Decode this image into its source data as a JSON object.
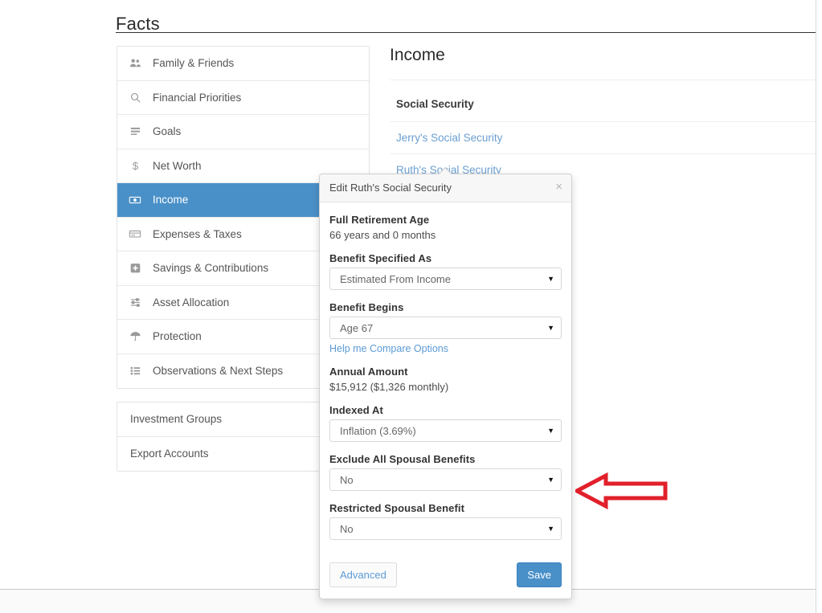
{
  "page": {
    "title": "Facts"
  },
  "sidebar": {
    "groups": [
      {
        "items": [
          {
            "label": "Family & Friends",
            "icon": "people-icon",
            "active": false
          },
          {
            "label": "Financial Priorities",
            "icon": "search-icon",
            "active": false
          },
          {
            "label": "Goals",
            "icon": "list-bars-icon",
            "active": false
          },
          {
            "label": "Net Worth",
            "icon": "dollar-icon",
            "active": false
          },
          {
            "label": "Income",
            "icon": "money-bill-icon",
            "active": true
          },
          {
            "label": "Expenses & Taxes",
            "icon": "credit-card-icon",
            "active": false
          },
          {
            "label": "Savings & Contributions",
            "icon": "plus-square-icon",
            "active": false
          },
          {
            "label": "Asset Allocation",
            "icon": "sliders-icon",
            "active": false
          },
          {
            "label": "Protection",
            "icon": "umbrella-icon",
            "active": false
          },
          {
            "label": "Observations & Next Steps",
            "icon": "bullet-list-icon",
            "active": false
          }
        ]
      },
      {
        "items": [
          {
            "label": "Investment Groups",
            "icon": "",
            "active": false
          },
          {
            "label": "Export Accounts",
            "icon": "",
            "active": false
          }
        ]
      }
    ]
  },
  "main": {
    "title": "Income",
    "section_heading": "Social Security",
    "rows": [
      {
        "label": "Jerry's Social Security"
      },
      {
        "label": "Ruth's Social Security"
      }
    ]
  },
  "modal": {
    "title": "Edit Ruth's Social Security",
    "close_label": "×",
    "fields": [
      {
        "label": "Full Retirement Age",
        "type": "static",
        "value": "66 years and 0 months"
      },
      {
        "label": "Benefit Specified As",
        "type": "select",
        "value": "Estimated From Income"
      },
      {
        "label": "Benefit Begins",
        "type": "select",
        "value": "Age 67",
        "link": "Help me Compare Options"
      },
      {
        "label": "Annual Amount",
        "type": "static",
        "value": "$15,912 ($1,326 monthly)"
      },
      {
        "label": "Indexed At",
        "type": "select",
        "value": "Inflation (3.69%)"
      },
      {
        "label": "Exclude All Spousal Benefits",
        "type": "select",
        "value": "No"
      },
      {
        "label": "Restricted Spousal Benefit",
        "type": "select",
        "value": "No"
      }
    ],
    "advanced_label": "Advanced",
    "save_label": "Save"
  },
  "annotation": {
    "shape": "left-arrow",
    "color": "#e1202b",
    "points_to": "Exclude All Spousal Benefits"
  },
  "colors": {
    "accent_blue": "#4a90c8",
    "link_blue": "#5b9bd5",
    "annotation_red": "#e1202b",
    "panel_border": "#e3e3e3"
  }
}
